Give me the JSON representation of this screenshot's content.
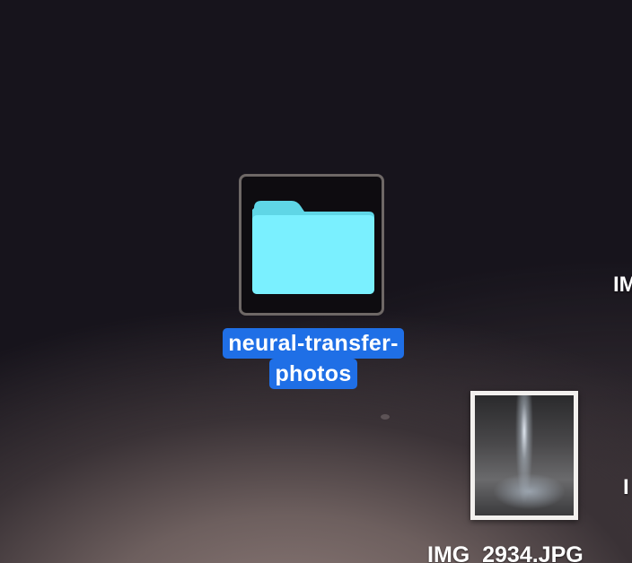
{
  "desktop": {
    "folder": {
      "icon": "folder-icon",
      "color": "#7af0ff",
      "label_line1": "neural-transfer-",
      "label_line2": "photos",
      "selected": true,
      "selection_color": "#1f6fe6"
    },
    "image_file": {
      "icon": "image-thumbnail",
      "label": "IMG_2934.JPG"
    },
    "edge_labels": [
      "IM",
      "I"
    ]
  }
}
